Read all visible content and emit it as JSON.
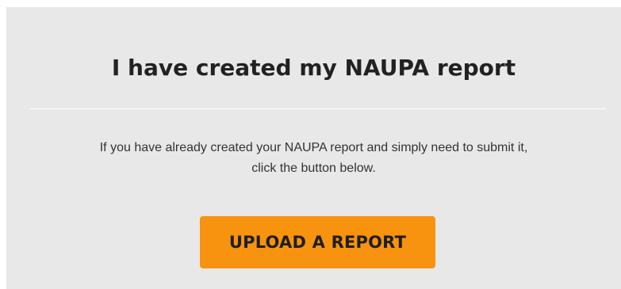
{
  "card": {
    "title": "I have created my NAUPA report",
    "description_line1": "If you have already created your NAUPA report and simply need to submit it,",
    "description_line2": "click the button below.",
    "button_label": "UPLOAD A REPORT"
  },
  "colors": {
    "card_background": "#e8e8e8",
    "button_background": "#f7930f",
    "title_text": "#222222"
  }
}
